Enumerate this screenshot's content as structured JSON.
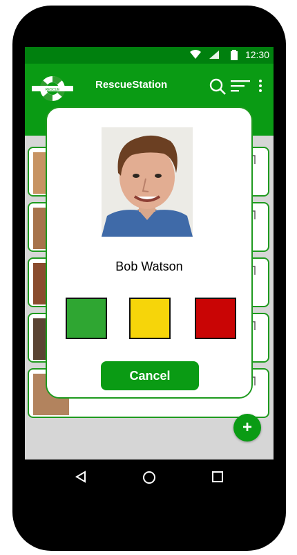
{
  "status_bar": {
    "time": "12:30"
  },
  "app": {
    "title": "RescueStation",
    "logo_text": "RESCUE"
  },
  "list": {
    "cards": [
      {
        "avatar_bg": "#c79363"
      },
      {
        "avatar_bg": "#a7734b"
      },
      {
        "avatar_bg": "#8a4c2e"
      },
      {
        "avatar_bg": "#5b4433"
      },
      {
        "avatar_bg": "#b2835e"
      }
    ]
  },
  "fab": {
    "label": "+"
  },
  "dialog": {
    "name": "Bob Watson",
    "status_options": [
      {
        "color": "#2fa632"
      },
      {
        "color": "#f6d50a"
      },
      {
        "color": "#c90505"
      }
    ],
    "cancel_label": "Cancel"
  },
  "colors": {
    "primary": "#0a9b14",
    "status_bar": "#00800e",
    "screen_bg": "#d6d6d6"
  }
}
